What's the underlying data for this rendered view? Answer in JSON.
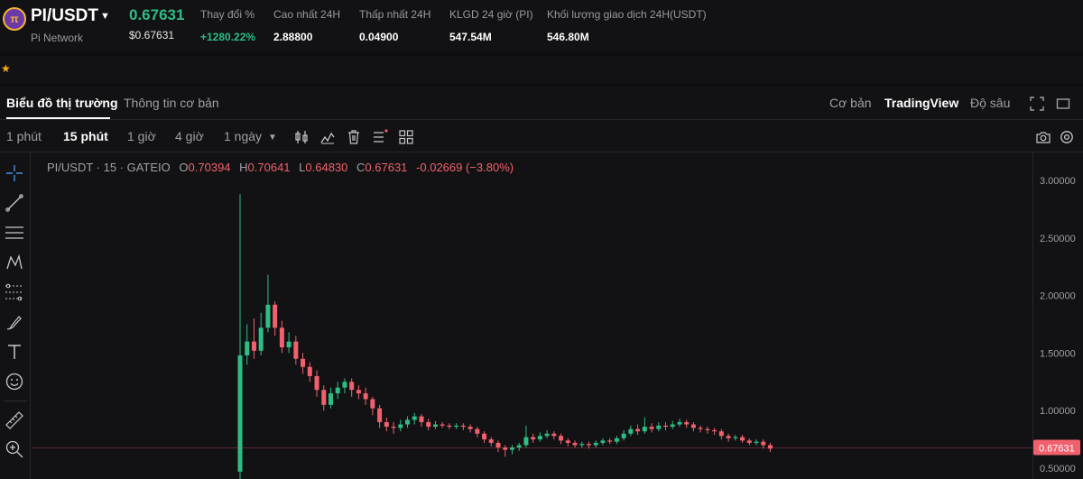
{
  "ticker": {
    "logo_glyph": "π",
    "pair": "PI/USDT",
    "network": "Pi Network",
    "last_price": "0.67631",
    "usd_price": "$0.67631",
    "stats": [
      {
        "label": "Thay đổi %",
        "value": "+1280.22%",
        "up": true
      },
      {
        "label": "Cao nhất 24H",
        "value": "2.88800"
      },
      {
        "label": "Thấp nhất 24H",
        "value": "0.04900"
      },
      {
        "label": "KLGD 24 giờ (PI)",
        "value": "547.54M"
      },
      {
        "label": "Khối lượng giao dịch 24H(USDT)",
        "value": "546.80M"
      }
    ]
  },
  "tabs": {
    "market_chart": "Biểu đồ thị trường",
    "basic_info": "Thông tin cơ bản"
  },
  "views": {
    "basic": "Cơ bản",
    "tradingview": "TradingView",
    "depth": "Độ sâu"
  },
  "intervals": [
    "1 phút",
    "15 phút",
    "1 giờ",
    "4 giờ",
    "1 ngày"
  ],
  "legend": {
    "symbol": "PI/USDT · 15 · GATEIO",
    "o_key": "O",
    "o_val": "0.70394",
    "h_key": "H",
    "h_val": "0.70641",
    "l_key": "L",
    "l_val": "0.64830",
    "c_key": "C",
    "c_val": "0.67631",
    "change": "-0.02669 (−3.80%)"
  },
  "colors": {
    "up": "#2ebd85",
    "down": "#f0616d",
    "accent_star": "#f5b10c"
  },
  "chart_data": {
    "type": "candlestick",
    "y_ticks": [
      "3.00000",
      "2.50000",
      "2.00000",
      "1.50000",
      "1.00000",
      "0.50000"
    ],
    "ylim": [
      0.45,
      3.2
    ],
    "current_price": 0.67631,
    "current_price_label": "0.67631",
    "candles": [
      [
        0.47,
        1.48,
        0.4,
        2.88
      ],
      [
        1.48,
        1.6,
        1.4,
        1.75
      ],
      [
        1.6,
        1.52,
        1.45,
        1.8
      ],
      [
        1.52,
        1.72,
        1.48,
        1.85
      ],
      [
        1.72,
        1.92,
        1.68,
        2.18
      ],
      [
        1.92,
        1.72,
        1.65,
        1.95
      ],
      [
        1.72,
        1.55,
        1.5,
        1.78
      ],
      [
        1.55,
        1.6,
        1.5,
        1.68
      ],
      [
        1.6,
        1.45,
        1.4,
        1.65
      ],
      [
        1.45,
        1.38,
        1.32,
        1.5
      ],
      [
        1.38,
        1.3,
        1.25,
        1.42
      ],
      [
        1.3,
        1.18,
        1.12,
        1.35
      ],
      [
        1.18,
        1.05,
        1.0,
        1.22
      ],
      [
        1.05,
        1.15,
        1.02,
        1.2
      ],
      [
        1.15,
        1.2,
        1.1,
        1.25
      ],
      [
        1.2,
        1.25,
        1.15,
        1.28
      ],
      [
        1.25,
        1.18,
        1.12,
        1.28
      ],
      [
        1.18,
        1.15,
        1.1,
        1.22
      ],
      [
        1.15,
        1.1,
        1.05,
        1.2
      ],
      [
        1.1,
        1.02,
        0.96,
        1.12
      ],
      [
        1.02,
        0.9,
        0.85,
        1.05
      ],
      [
        0.9,
        0.86,
        0.82,
        0.94
      ],
      [
        0.86,
        0.85,
        0.8,
        0.9
      ],
      [
        0.85,
        0.88,
        0.82,
        0.92
      ],
      [
        0.88,
        0.92,
        0.85,
        0.95
      ],
      [
        0.92,
        0.95,
        0.88,
        0.98
      ],
      [
        0.95,
        0.9,
        0.86,
        0.97
      ],
      [
        0.9,
        0.86,
        0.83,
        0.93
      ],
      [
        0.86,
        0.88,
        0.84,
        0.91
      ],
      [
        0.88,
        0.87,
        0.85,
        0.9
      ],
      [
        0.87,
        0.86,
        0.84,
        0.89
      ],
      [
        0.86,
        0.87,
        0.84,
        0.89
      ],
      [
        0.87,
        0.86,
        0.83,
        0.89
      ],
      [
        0.86,
        0.84,
        0.81,
        0.88
      ],
      [
        0.84,
        0.8,
        0.77,
        0.86
      ],
      [
        0.8,
        0.75,
        0.72,
        0.82
      ],
      [
        0.75,
        0.72,
        0.69,
        0.77
      ],
      [
        0.72,
        0.68,
        0.64,
        0.74
      ],
      [
        0.68,
        0.66,
        0.6,
        0.7
      ],
      [
        0.66,
        0.68,
        0.62,
        0.7
      ],
      [
        0.68,
        0.7,
        0.65,
        0.72
      ],
      [
        0.7,
        0.77,
        0.68,
        0.87
      ],
      [
        0.77,
        0.75,
        0.72,
        0.8
      ],
      [
        0.75,
        0.78,
        0.73,
        0.81
      ],
      [
        0.78,
        0.8,
        0.76,
        0.83
      ],
      [
        0.8,
        0.78,
        0.75,
        0.82
      ],
      [
        0.78,
        0.74,
        0.71,
        0.8
      ],
      [
        0.74,
        0.72,
        0.69,
        0.76
      ],
      [
        0.72,
        0.7,
        0.68,
        0.74
      ],
      [
        0.7,
        0.71,
        0.68,
        0.73
      ],
      [
        0.71,
        0.7,
        0.67,
        0.73
      ],
      [
        0.7,
        0.72,
        0.68,
        0.74
      ],
      [
        0.72,
        0.74,
        0.7,
        0.76
      ],
      [
        0.74,
        0.73,
        0.71,
        0.76
      ],
      [
        0.73,
        0.76,
        0.71,
        0.78
      ],
      [
        0.76,
        0.8,
        0.74,
        0.83
      ],
      [
        0.8,
        0.84,
        0.78,
        0.87
      ],
      [
        0.84,
        0.82,
        0.79,
        0.88
      ],
      [
        0.82,
        0.86,
        0.8,
        0.94
      ],
      [
        0.86,
        0.84,
        0.81,
        0.89
      ],
      [
        0.84,
        0.87,
        0.82,
        0.9
      ],
      [
        0.87,
        0.86,
        0.83,
        0.9
      ],
      [
        0.86,
        0.88,
        0.84,
        0.91
      ],
      [
        0.88,
        0.9,
        0.86,
        0.93
      ],
      [
        0.9,
        0.88,
        0.85,
        0.92
      ],
      [
        0.88,
        0.85,
        0.82,
        0.9
      ],
      [
        0.85,
        0.84,
        0.81,
        0.87
      ],
      [
        0.84,
        0.83,
        0.8,
        0.86
      ],
      [
        0.83,
        0.82,
        0.79,
        0.85
      ],
      [
        0.82,
        0.78,
        0.75,
        0.84
      ],
      [
        0.78,
        0.76,
        0.73,
        0.8
      ],
      [
        0.76,
        0.77,
        0.74,
        0.79
      ],
      [
        0.77,
        0.74,
        0.72,
        0.79
      ],
      [
        0.74,
        0.72,
        0.7,
        0.76
      ],
      [
        0.72,
        0.73,
        0.7,
        0.75
      ],
      [
        0.73,
        0.7,
        0.67,
        0.75
      ],
      [
        0.7,
        0.67,
        0.64,
        0.72
      ]
    ]
  }
}
